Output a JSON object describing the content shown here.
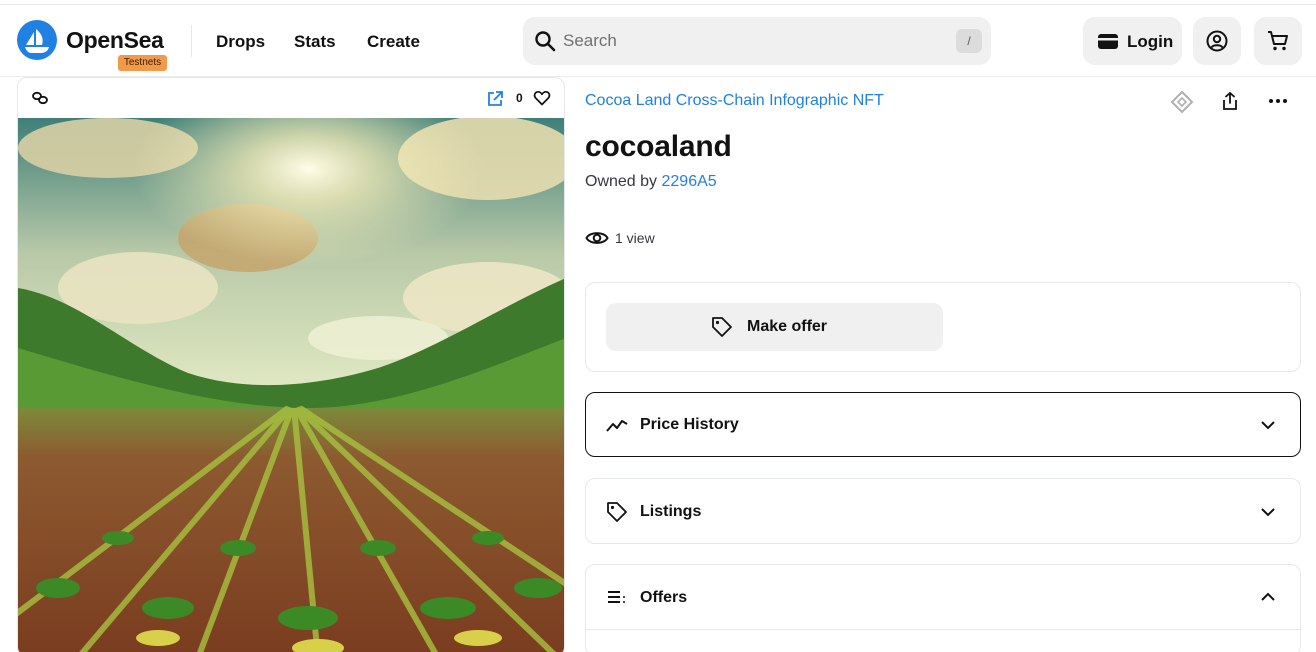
{
  "header": {
    "brand": "OpenSea",
    "badge": "Testnets",
    "nav": [
      "Drops",
      "Stats",
      "Create"
    ],
    "search_placeholder": "Search",
    "search_shortcut": "/",
    "login_label": "Login"
  },
  "item": {
    "favorite_count": "0",
    "collection": "Cocoa Land Cross-Chain Infographic NFT",
    "title": "cocoaland",
    "owned_by_label": "Owned by",
    "owner": "2296A5",
    "views": "1 view"
  },
  "actions": {
    "make_offer_label": "Make offer"
  },
  "sections": [
    {
      "label": "Price History"
    },
    {
      "label": "Listings"
    },
    {
      "label": "Offers"
    }
  ],
  "colors": {
    "accent": "#2081e2",
    "badge": "#f2994a",
    "button_bg": "#f0f0f0"
  }
}
